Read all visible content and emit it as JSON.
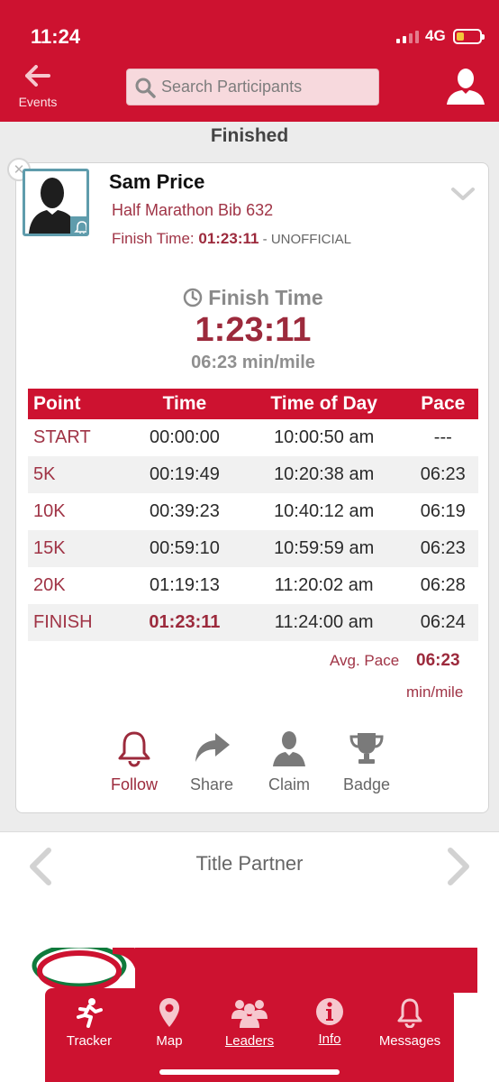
{
  "status_bar": {
    "time": "11:24",
    "network": "4G"
  },
  "header": {
    "back_label": "Events",
    "search_placeholder": "Search Participants"
  },
  "section_title": "Finished",
  "runner": {
    "name": "Sam Price",
    "race_info": "Half Marathon Bib 632",
    "finish_prefix": "Finish Time: ",
    "finish_time": "01:23:11",
    "finish_suffix": " - UNOFFICIAL"
  },
  "finish_summary": {
    "heading": "Finish Time",
    "time": "1:23:11",
    "pace": "06:23 min/mile"
  },
  "splits": {
    "headers": [
      "Point",
      "Time",
      "Time of Day",
      "Pace"
    ],
    "rows": [
      [
        "START",
        "00:00:00",
        "10:00:50 am",
        "---"
      ],
      [
        "5K",
        "00:19:49",
        "10:20:38 am",
        "06:23"
      ],
      [
        "10K",
        "00:39:23",
        "10:40:12 am",
        "06:19"
      ],
      [
        "15K",
        "00:59:10",
        "10:59:59 am",
        "06:23"
      ],
      [
        "20K",
        "01:19:13",
        "11:20:02 am",
        "06:28"
      ],
      [
        "FINISH",
        "01:23:11",
        "11:24:00 am",
        "06:24"
      ]
    ]
  },
  "avg_pace": {
    "label": "Avg. Pace",
    "value": "06:23",
    "unit": "min/mile"
  },
  "actions": {
    "follow": "Follow",
    "share": "Share",
    "claim": "Claim",
    "badge": "Badge"
  },
  "partner": {
    "title": "Title Partner"
  },
  "tabs": {
    "tracker": "Tracker",
    "map": "Map",
    "leaders": "Leaders",
    "info": "Info",
    "messages": "Messages"
  },
  "colors": {
    "brand": "#cd1230",
    "accent": "#9c2a3c",
    "avatar_frame": "#5f9cac"
  }
}
